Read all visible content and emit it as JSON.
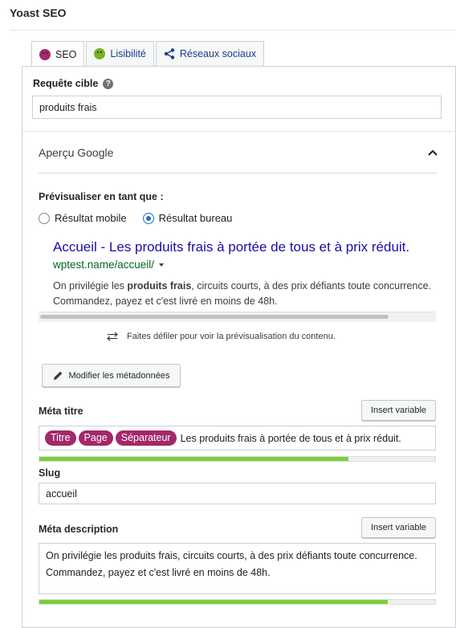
{
  "app": {
    "title": "Yoast SEO"
  },
  "tabs": [
    {
      "label": "SEO",
      "icon": "seo-score-bad-icon",
      "active": true
    },
    {
      "label": "Lisibilité",
      "icon": "readability-good-icon",
      "active": false
    },
    {
      "label": "Réseaux sociaux",
      "icon": "share-icon",
      "active": false
    }
  ],
  "focus_keyphrase": {
    "label": "Requête cible",
    "help_icon": "?",
    "value": "produits frais"
  },
  "google_preview": {
    "header": "Aperçu Google",
    "preview_as_label": "Prévisualiser en tant que :",
    "mobile_label": "Résultat mobile",
    "desktop_label": "Résultat bureau",
    "selected_mode": "desktop",
    "serp": {
      "title": "Accueil - Les produits frais à portée de tous et à prix réduit.",
      "url": "wptest.name/accueil/",
      "desc_before": "On privilégie les ",
      "desc_bold": "produits frais",
      "desc_after": ", circuits courts, à des prix défiants toute concurrence. Commandez, payez et c'est livré en moins de 48h."
    },
    "scroll_hint": "Faites défiler pour voir la prévisualisation du contenu.",
    "edit_button": "Modifier les métadonnées"
  },
  "meta_title": {
    "label": "Méta titre",
    "insert_variable": "Insert variable",
    "pills": [
      "Titre",
      "Page",
      "Séparateur"
    ],
    "text": "Les produits frais à portée de tous et à prix réduit.",
    "progress": 0.78
  },
  "slug": {
    "label": "Slug",
    "value": "accueil"
  },
  "meta_description": {
    "label": "Méta description",
    "insert_variable": "Insert variable",
    "value": "On privilégie les produits frais, circuits courts, à des prix défiants toute concurrence. Commandez, payez et c'est livré en moins de 48h.",
    "progress": 0.88
  },
  "colors": {
    "accent_purple": "#a4286a",
    "link_blue": "#1a0dab",
    "url_green": "#006621",
    "progress_green": "#7ad03a"
  }
}
